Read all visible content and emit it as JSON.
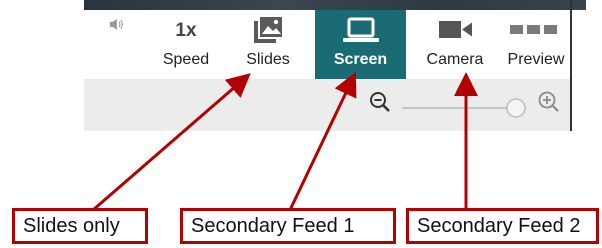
{
  "toolbar": {
    "speed_value": "1x",
    "speed_label": "Speed",
    "slides_label": "Slides",
    "screen_label": "Screen",
    "camera_label": "Camera",
    "preview_label": "Preview"
  },
  "zoom": {
    "level": 1.0
  },
  "callouts": {
    "slides_only": "Slides only",
    "secondary_feed_1": "Secondary Feed 1",
    "secondary_feed_2": "Secondary Feed 2"
  },
  "colors": {
    "active_tab": "#1a6b73",
    "callout": "#b30000"
  },
  "icons": [
    "volume-icon",
    "slides-icon",
    "screen-icon",
    "camera-icon",
    "preview-icon",
    "zoom-out-icon",
    "zoom-in-icon"
  ]
}
